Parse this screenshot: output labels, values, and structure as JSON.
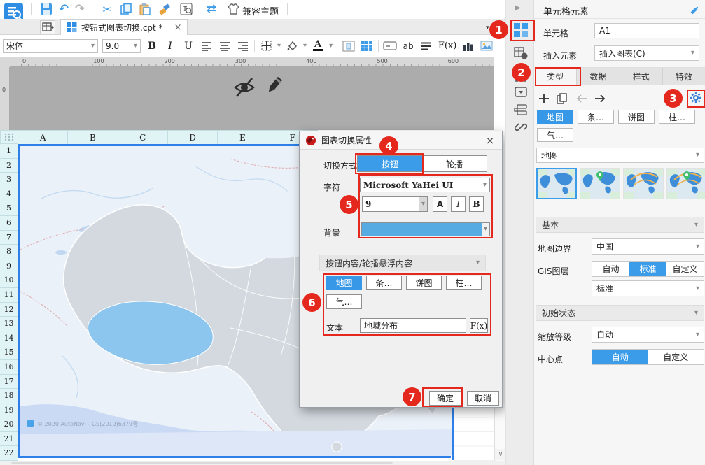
{
  "colors": {
    "accent": "#3b9cea",
    "annotation_red": "#e5281e",
    "selection_blue": "#2e7fe8",
    "header_bg": "#e0f4f6",
    "tibet_blue": "#8cc5ee",
    "land_gray": "#d3d9df",
    "sea": "#cbdaf4",
    "dialog_swatch": "#57abe3"
  },
  "icons": {
    "undo": "↶",
    "redo": "↷",
    "cut": "✂",
    "swap": "⇄",
    "chevron_down": "▾",
    "close": "×",
    "collapse_right": "▶",
    "scroll_down": "∨"
  },
  "toolbar": {
    "theme_label": "兼容主题"
  },
  "tab_bar": {
    "tab_title": "按钮式图表切换.cpt *",
    "close": "×"
  },
  "format_bar": {
    "font_name": "宋体",
    "font_size": "9.0",
    "bold": "B",
    "italic": "I",
    "underline": "U",
    "ab": "ab",
    "formula": "F(x)"
  },
  "ruler": {
    "h_labels": [
      "0",
      "100",
      "200",
      "300",
      "400",
      "500",
      "600"
    ],
    "v_label": "0"
  },
  "sheet": {
    "columns": [
      "A",
      "B",
      "C",
      "D",
      "E",
      "F"
    ],
    "rows": [
      "1",
      "2",
      "3",
      "4",
      "5",
      "6",
      "7",
      "8",
      "9",
      "10",
      "11",
      "12",
      "13",
      "14",
      "15",
      "16",
      "17",
      "18",
      "19",
      "20",
      "21",
      "22"
    ],
    "attribution": "© 2020 AutoNavi - GS(2019)6379号"
  },
  "dialog": {
    "title": "图表切换属性",
    "switch_label": "切换方式",
    "switch_options": [
      "按钮",
      "轮播"
    ],
    "switch_selected": 0,
    "font_label": "字符",
    "font_value": "Microsoft YaHei UI",
    "size_value": "9",
    "style_a": "A",
    "style_i": "I",
    "style_b": "B",
    "bg_label": "背景",
    "content_header": "按钮内容/轮播悬浮内容",
    "chart_buttons": [
      "地图",
      "条…",
      "饼图",
      "柱…",
      "气…"
    ],
    "chart_selected": 0,
    "text_label": "文本",
    "text_value": "地域分布",
    "formula": "F(x)",
    "ok": "确定",
    "cancel": "取消"
  },
  "sidebar": {
    "title": "单元格元素",
    "cell_label": "单元格",
    "cell_value": "A1",
    "insert_label": "插入元素",
    "insert_value": "插入图表(C)",
    "tabs": [
      "类型",
      "数据",
      "样式",
      "特效"
    ],
    "tab_selected": 0,
    "chart_buttons": [
      "地图",
      "条…",
      "饼图",
      "柱…",
      "气…"
    ],
    "chart_selected": 0,
    "chart_dropdown": "地图",
    "basic_header": "基本",
    "boundary_label": "地图边界",
    "boundary_value": "中国",
    "gis_label": "GIS图层",
    "gis_options": [
      "自动",
      "标准",
      "自定义"
    ],
    "gis_selected": 1,
    "gis_dropdown": "标准",
    "init_header": "初始状态",
    "zoom_label": "缩放等级",
    "zoom_value": "自动",
    "center_label": "中心点",
    "center_options": [
      "自动",
      "自定义"
    ],
    "center_selected": 0
  },
  "annotations": [
    "1",
    "2",
    "3",
    "4",
    "5",
    "6",
    "7"
  ]
}
